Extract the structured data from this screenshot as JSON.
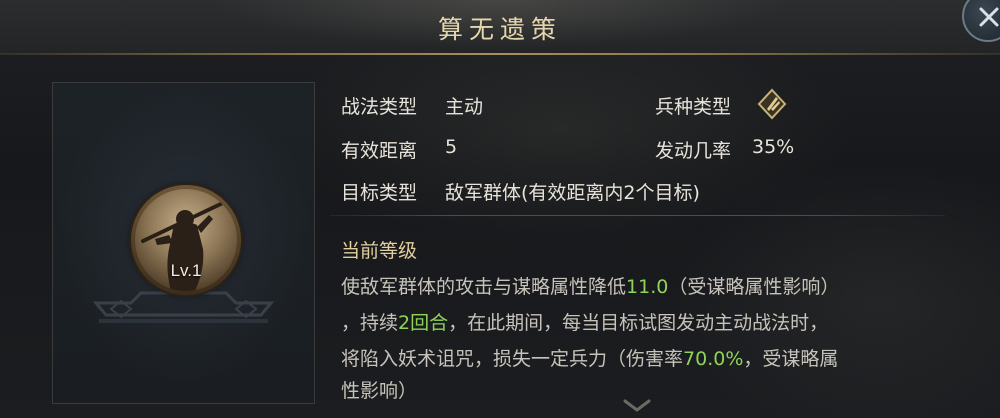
{
  "window": {
    "title": "算无遗策"
  },
  "skill": {
    "level": "Lv.1"
  },
  "info": {
    "type_label": "战法类型",
    "type_value": "主动",
    "troop_label": "兵种类型",
    "distance_label": "有效距离",
    "distance_value": "5",
    "rate_label": "发动几率",
    "rate_value": "35%",
    "target_label": "目标类型",
    "target_value": "敌军群体(有效距离内2个目标)"
  },
  "description": {
    "section_title": "当前等级",
    "line1_a": "使敌军群体的攻击与谋略属性降低",
    "line1_hl": "11.0",
    "line1_b": "（受谋略属性影响）",
    "line2_a": "，持续",
    "line2_hl": "2回合",
    "line2_b": "，在此期间，每当目标试图发动主动战法时，",
    "line3_a": "将陷入妖术诅咒，损失一定兵力（伤害率",
    "line3_hl": "70.0%",
    "line3_b": "，受谋略属",
    "line4": "性影响）"
  },
  "icons": {
    "close": "close-icon",
    "troop_type": "troop-type-icon",
    "scroll_down": "chevron-down-icon",
    "skill_portrait": "skill-portrait-icon"
  },
  "colors": {
    "title": "#e6d6ae",
    "highlight": "#8fd35a",
    "section_title": "#e2cf9f",
    "text": "#e7e3da"
  }
}
